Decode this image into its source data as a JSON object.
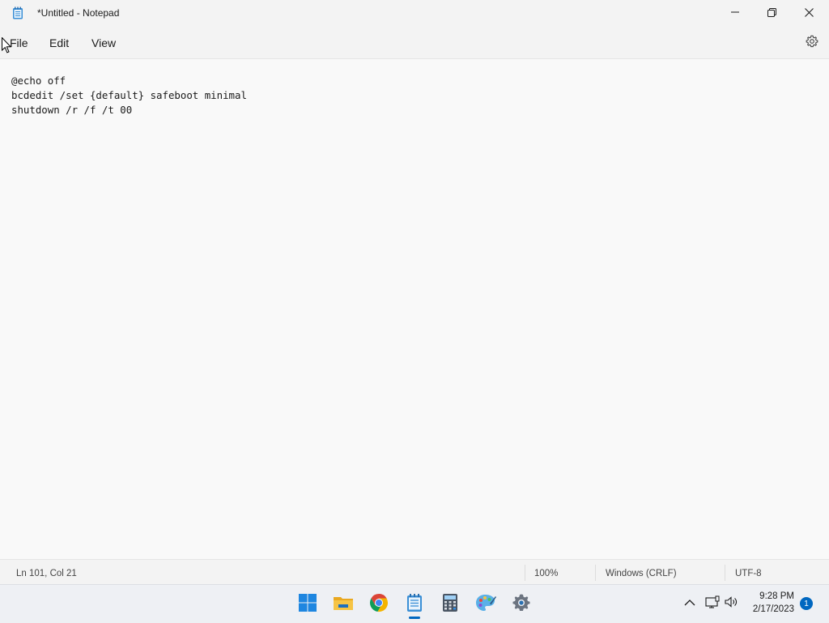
{
  "window": {
    "title": "*Untitled - Notepad",
    "app_icon": "notepad-icon",
    "controls": [
      "minimize-icon",
      "restore-icon",
      "close-icon"
    ]
  },
  "menu": {
    "file": "File",
    "edit": "Edit",
    "view": "View",
    "settings_icon": "gear-icon"
  },
  "editor": {
    "content": "@echo off\nbcdedit /set {default} safeboot minimal\nshutdown /r /f /t 00"
  },
  "status": {
    "position": "Ln 101, Col 21",
    "zoom": "100%",
    "line_ending": "Windows (CRLF)",
    "encoding": "UTF-8"
  },
  "taskbar": {
    "apps": [
      "start-icon",
      "file-explorer-icon",
      "chrome-icon",
      "notepad-icon",
      "calculator-icon",
      "paint-icon",
      "settings-icon"
    ],
    "active_app": "notepad-icon",
    "clock_time": "9:28 PM",
    "clock_date": "2/17/2023",
    "notifications": "1"
  },
  "colors": {
    "accent": "#0067c0",
    "background": "#f9f9f9",
    "chrome": "#f3f3f3"
  }
}
